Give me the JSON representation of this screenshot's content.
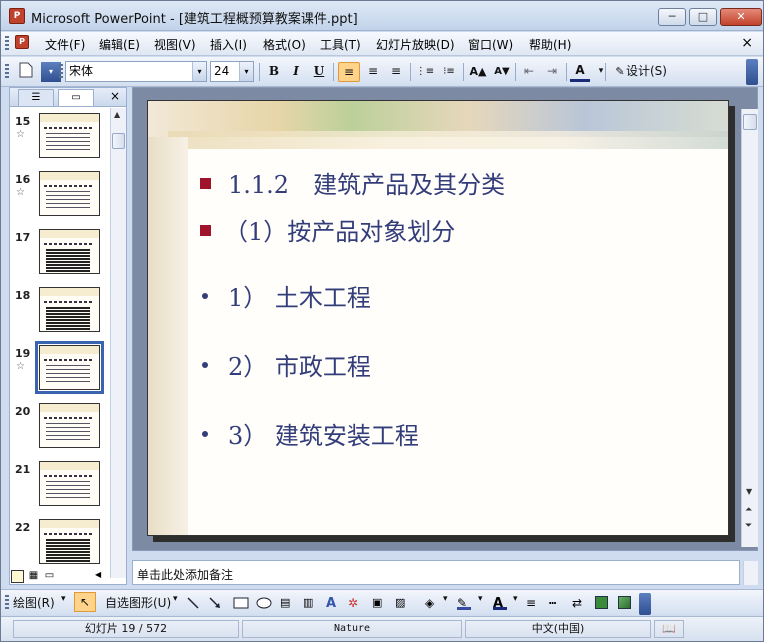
{
  "window": {
    "app_title": "Microsoft PowerPoint - [建筑工程概预算教案课件.ppt]",
    "app_icon_text": "P",
    "min_label": "─",
    "max_label": "□",
    "close_label": "✕"
  },
  "menubar": {
    "items": [
      "文件(F)",
      "编辑(E)",
      "视图(V)",
      "插入(I)",
      "格式(O)",
      "工具(T)",
      "幻灯片放映(D)",
      "窗口(W)",
      "帮助(H)"
    ],
    "close": "×"
  },
  "toolbar": {
    "font_name": "宋体",
    "font_size": "24",
    "bold": "B",
    "italic": "I",
    "underline": "U",
    "align_left": "≡",
    "align_center": "≡",
    "align_right": "≡",
    "numbering": "⋮≡",
    "bullets": "⁝≡",
    "grow_font": "A▲",
    "shrink_font": "A▼",
    "indent_less": "⇤",
    "indent_more": "⇥",
    "font_color": "A",
    "design": "设计(S)",
    "dropdown_arrow": "▾"
  },
  "left_panel": {
    "tab_outline": "☰",
    "tab_slides": "▭",
    "close": "×",
    "slides": [
      {
        "num": "15",
        "star": "☆"
      },
      {
        "num": "16",
        "star": "☆"
      },
      {
        "num": "17",
        "star": ""
      },
      {
        "num": "18",
        "star": ""
      },
      {
        "num": "19",
        "star": "☆",
        "selected": true
      },
      {
        "num": "20",
        "star": ""
      },
      {
        "num": "21",
        "star": ""
      },
      {
        "num": "22",
        "star": ""
      }
    ],
    "scroll_up": "▲",
    "scroll_down": "▼"
  },
  "slide": {
    "line1": "1.1.2　建筑产品及其分类",
    "line2": "（1）按产品对象划分",
    "line3": "1） 土木工程",
    "line4": "2） 市政工程",
    "line5": "3） 建筑安装工程",
    "bullet_color": "#a0132b",
    "text_color": "#333d7a"
  },
  "notes": {
    "placeholder": "单击此处添加备注"
  },
  "drawbar": {
    "draw": "绘图(R)",
    "autoshapes": "自选图形(U)",
    "dropdown_arrow": "▾"
  },
  "statusbar": {
    "slide_info": "幻灯片 19 / 572",
    "design_name": "Nature",
    "language": "中文(中国)"
  }
}
